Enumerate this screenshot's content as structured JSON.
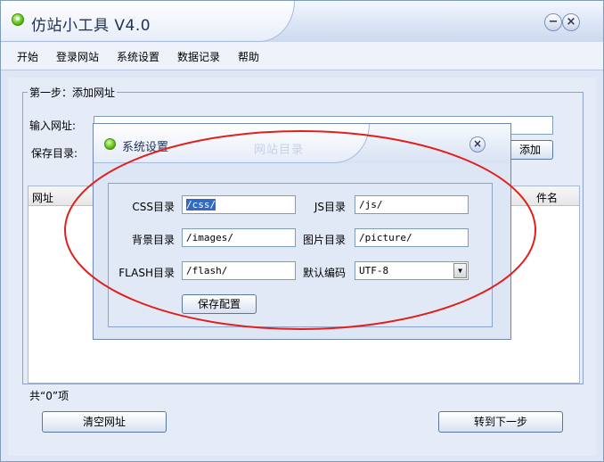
{
  "window": {
    "title": "仿站小工具 V4.0",
    "minimize": "−",
    "close": "×"
  },
  "menu": [
    "开始",
    "登录网站",
    "系统设置",
    "数据记录",
    "帮助"
  ],
  "step1": {
    "group_title": "第一步：添加网址",
    "url_label": "输入网址:",
    "url_value": "",
    "save_dir_label": "保存目录:",
    "add_button": "添加",
    "columns": [
      "网址",
      "件名"
    ],
    "count_text": "共“0”项",
    "clear_button": "清空网址",
    "next_button": "转到下一步"
  },
  "dialog": {
    "title": "系统设置",
    "ghost_text": "网站目录",
    "close": "×",
    "fields": {
      "css_label": "CSS目录",
      "css_value": "/css/",
      "js_label": "JS目录",
      "js_value": "/js/",
      "bg_label": "背景目录",
      "bg_value": "/images/",
      "pic_label": "图片目录",
      "pic_value": "/picture/",
      "flash_label": "FLASH目录",
      "flash_value": "/flash/",
      "encoding_label": "默认编码",
      "encoding_value": "UTF-8"
    },
    "save_button": "保存配置"
  },
  "annotation": {
    "color": "#e0201c",
    "shape": "ellipse"
  }
}
